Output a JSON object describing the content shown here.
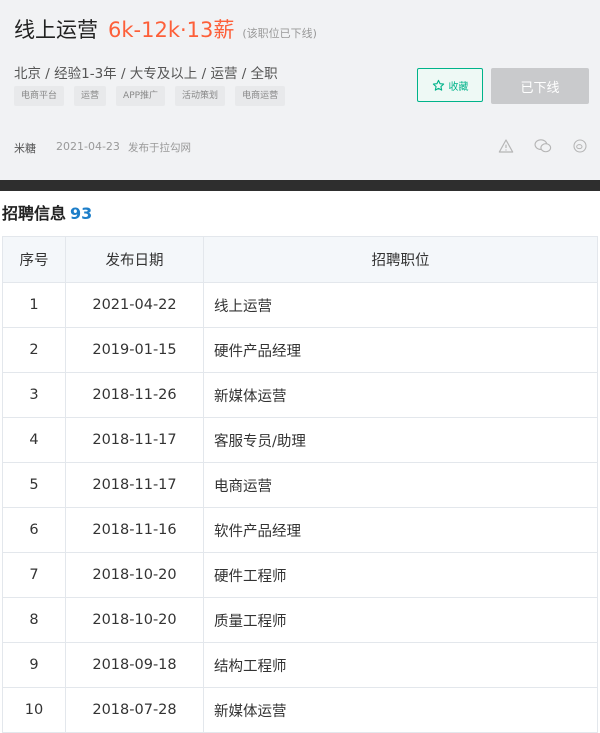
{
  "job": {
    "title": "线上运营",
    "salary": "6k-12k·13薪",
    "status_note": "(该职位已下线)",
    "requirements": "北京 / 经验1-3年 / 大专及以上 / 运营 / 全职",
    "tags": [
      "电商平台",
      "运营",
      "APP推广",
      "活动策划",
      "电商运营"
    ],
    "publisher": "米糖",
    "publish_date": "2021-04-23",
    "publish_source": "发布于拉勾网"
  },
  "actions": {
    "collect_label": "收藏",
    "offline_label": "已下线"
  },
  "colors": {
    "accent_green": "#00b38a",
    "salary_orange": "#fd5f39",
    "count_blue": "#1d7ec9"
  },
  "recruit": {
    "title": "招聘信息",
    "count": "93",
    "headers": [
      "序号",
      "发布日期",
      "招聘职位"
    ],
    "rows": [
      [
        "1",
        "2021-04-22",
        "线上运营"
      ],
      [
        "2",
        "2019-01-15",
        "硬件产品经理"
      ],
      [
        "3",
        "2018-11-26",
        "新媒体运营"
      ],
      [
        "4",
        "2018-11-17",
        "客服专员/助理"
      ],
      [
        "5",
        "2018-11-17",
        "电商运营"
      ],
      [
        "6",
        "2018-11-16",
        "软件产品经理"
      ],
      [
        "7",
        "2018-10-20",
        "硬件工程师"
      ],
      [
        "8",
        "2018-10-20",
        "质量工程师"
      ],
      [
        "9",
        "2018-09-18",
        "结构工程师"
      ],
      [
        "10",
        "2018-07-28",
        "新媒体运营"
      ]
    ]
  }
}
